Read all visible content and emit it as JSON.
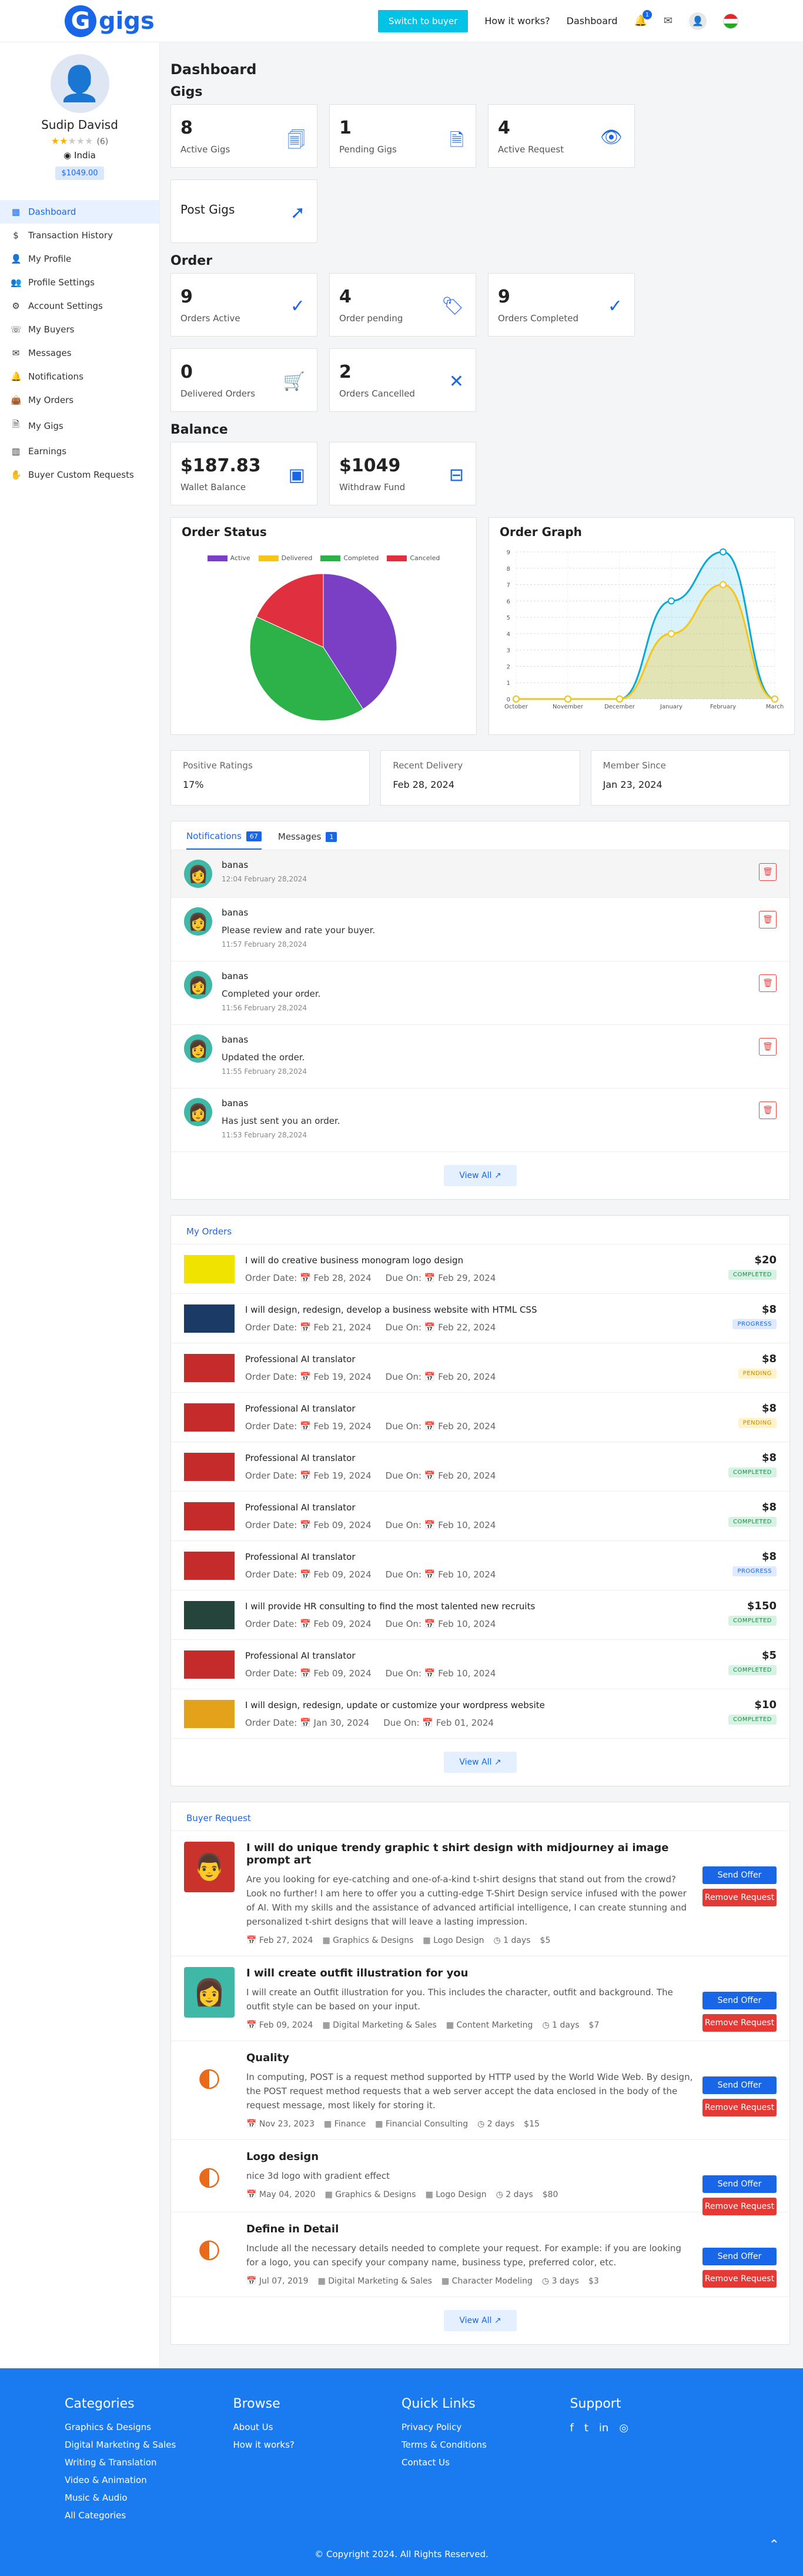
{
  "brand": {
    "logo_letter": "G",
    "logo_text": "gigs"
  },
  "topnav": {
    "switch_label": "Switch to buyer",
    "how": "How it works?",
    "dashboard": "Dashboard",
    "notif_count": "1"
  },
  "profile": {
    "name": "Sudip Davisd",
    "rating_count": "(6)",
    "country": "India",
    "wallet": "$1049.00",
    "rating": 2
  },
  "sidebar": [
    {
      "label": "Dashboard",
      "icon": "grid-icon"
    },
    {
      "label": "Transaction History",
      "icon": "dollar-icon"
    },
    {
      "label": "My Profile",
      "icon": "user-icon"
    },
    {
      "label": "Profile Settings",
      "icon": "users-icon"
    },
    {
      "label": "Account Settings",
      "icon": "gear-icon"
    },
    {
      "label": "My Buyers",
      "icon": "phone-icon"
    },
    {
      "label": "Messages",
      "icon": "mail-icon"
    },
    {
      "label": "Notifications",
      "icon": "bell-icon"
    },
    {
      "label": "My Orders",
      "icon": "bag-icon"
    },
    {
      "label": "My Gigs",
      "icon": "file-icon"
    },
    {
      "label": "Earnings",
      "icon": "chart-icon"
    },
    {
      "label": "Buyer Custom Requests",
      "icon": "hand-icon"
    }
  ],
  "dashboard": {
    "title": "Dashboard",
    "gigs_title": "Gigs",
    "order_title": "Order",
    "balance_title": "Balance"
  },
  "gigs": [
    {
      "num": "8",
      "label": "Active Gigs",
      "icon": "document-icon"
    },
    {
      "num": "1",
      "label": "Pending Gigs",
      "icon": "file-icon"
    },
    {
      "num": "4",
      "label": "Active Request",
      "icon": "eye-icon"
    },
    {
      "num": "",
      "label": "Post Gigs",
      "icon": "cursor-icon"
    }
  ],
  "order": [
    {
      "num": "9",
      "label": "Orders Active",
      "icon": "check-icon"
    },
    {
      "num": "4",
      "label": "Order pending",
      "icon": "tag-icon"
    },
    {
      "num": "9",
      "label": "Orders Completed",
      "icon": "check-icon"
    },
    {
      "num": "0",
      "label": "Delivered Orders",
      "icon": "cart-icon"
    },
    {
      "num": "2",
      "label": "Orders Cancelled",
      "icon": "close-icon"
    }
  ],
  "balance": [
    {
      "num": "$187.83",
      "label": "Wallet Balance",
      "icon": "wallet-icon"
    },
    {
      "num": "$1049",
      "label": "Withdraw Fund",
      "icon": "tray-icon"
    }
  ],
  "order_status": {
    "title": "Order Status",
    "colors": [
      "#7b3fc6",
      "#f5c518",
      "#2db24a",
      "#e0303f"
    ]
  },
  "order_graph": {
    "title": "Order Graph"
  },
  "chart_data": [
    {
      "type": "pie",
      "categories": [
        "Active",
        "Delivered",
        "Completed",
        "Canceled"
      ],
      "values": [
        9,
        0,
        9,
        4
      ],
      "title": "Order Status"
    },
    {
      "type": "area",
      "title": "Order Graph",
      "categories": [
        "October",
        "November",
        "December",
        "January",
        "February",
        "March"
      ],
      "series": [
        {
          "values": [
            0,
            0,
            0,
            6,
            9,
            0
          ],
          "color": "#0aa8d6"
        },
        {
          "values": [
            0,
            0,
            0,
            4,
            7,
            0
          ],
          "color": "#f5c518"
        }
      ],
      "ylim": [
        0,
        9
      ],
      "yticks": [
        0,
        1,
        2,
        3,
        4,
        5,
        6,
        7,
        8,
        9
      ],
      "grid": true
    }
  ],
  "stats": [
    {
      "title": "Positive Ratings",
      "value": "17%"
    },
    {
      "title": "Recent Delivery",
      "value": "Feb 28, 2024"
    },
    {
      "title": "Member Since",
      "value": "Jan 23, 2024"
    }
  ],
  "notifications": {
    "tab_notifications": "Notifications",
    "tab_notifications_count": "67",
    "tab_messages": "Messages",
    "tab_messages_count": "1",
    "view_all": "View All ↗",
    "items": [
      {
        "who": "banas",
        "msg": "",
        "time": "12:04 February 28,2024"
      },
      {
        "who": "banas",
        "msg": "Please review and rate your buyer.",
        "time": "11:57 February 28,2024"
      },
      {
        "who": "banas",
        "msg": "Completed your order.",
        "time": "11:56 February 28,2024"
      },
      {
        "who": "banas",
        "msg": "Updated the order.",
        "time": "11:55 February 28,2024"
      },
      {
        "who": "banas",
        "msg": "Has just sent you an order.",
        "time": "11:53 February 28,2024"
      }
    ]
  },
  "orders": {
    "title": "My Orders",
    "view_all": "View All ↗",
    "items": [
      {
        "title": "I will do creative business monogram logo design",
        "order": "Order Date: 📅 Feb 28, 2024",
        "due": "Due On: 📅 Feb 29, 2024",
        "price": "$20",
        "status": "COMPLETED",
        "cls": "s-completed",
        "thumb": "#f0e300"
      },
      {
        "title": "I will design, redesign, develop a business website with HTML CSS",
        "order": "Order Date: 📅 Feb 21, 2024",
        "due": "Due On: 📅 Feb 22, 2024",
        "price": "$8",
        "status": "PROGRESS",
        "cls": "s-progress",
        "thumb": "#1c3a66"
      },
      {
        "title": "Professional AI translator",
        "order": "Order Date: 📅 Feb 19, 2024",
        "due": "Due On: 📅 Feb 20, 2024",
        "price": "$8",
        "status": "PENDING",
        "cls": "s-pending",
        "thumb": "#c62b2b"
      },
      {
        "title": "Professional AI translator",
        "order": "Order Date: 📅 Feb 19, 2024",
        "due": "Due On: 📅 Feb 20, 2024",
        "price": "$8",
        "status": "PENDING",
        "cls": "s-pending",
        "thumb": "#c62b2b"
      },
      {
        "title": "Professional AI translator",
        "order": "Order Date: 📅 Feb 19, 2024",
        "due": "Due On: 📅 Feb 20, 2024",
        "price": "$8",
        "status": "COMPLETED",
        "cls": "s-completed",
        "thumb": "#c62b2b"
      },
      {
        "title": "Professional AI translator",
        "order": "Order Date: 📅 Feb 09, 2024",
        "due": "Due On: 📅 Feb 10, 2024",
        "price": "$8",
        "status": "COMPLETED",
        "cls": "s-completed",
        "thumb": "#c62b2b"
      },
      {
        "title": "Professional AI translator",
        "order": "Order Date: 📅 Feb 09, 2024",
        "due": "Due On: 📅 Feb 10, 2024",
        "price": "$8",
        "status": "PROGRESS",
        "cls": "s-progress",
        "thumb": "#c62b2b"
      },
      {
        "title": "I will provide HR consulting to find the most talented new recruits",
        "order": "Order Date: 📅 Feb 09, 2024",
        "due": "Due On: 📅 Feb 10, 2024",
        "price": "$150",
        "status": "COMPLETED",
        "cls": "s-completed",
        "thumb": "#24443c"
      },
      {
        "title": "Professional AI translator",
        "order": "Order Date: 📅 Feb 09, 2024",
        "due": "Due On: 📅 Feb 10, 2024",
        "price": "$5",
        "status": "COMPLETED",
        "cls": "s-completed",
        "thumb": "#c62b2b"
      },
      {
        "title": "I will design, redesign, update or customize your wordpress website",
        "order": "Order Date: 📅 Jan 30, 2024",
        "due": "Due On: 📅 Feb 01, 2024",
        "price": "$10",
        "status": "COMPLETED",
        "cls": "s-completed",
        "thumb": "#e3a21a"
      }
    ]
  },
  "requests": {
    "title": "Buyer Request",
    "send": "Send Offer",
    "remove": "Remove Request",
    "view_all": "View All ↗",
    "items": [
      {
        "title": "I will do unique trendy graphic t shirt design with midjourney ai image prompt art",
        "desc": "Are you looking for eye-catching and one-of-a-kind t-shirt designs that stand out from the crowd? Look no further! I am here to offer you a cutting-edge T-Shirt Design service infused with the power of AI. With my skills and the assistance of advanced artificial intelligence, I can create stunning and personalized t-shirt designs that will leave a lasting impression.",
        "date": "📅 Feb 27, 2024",
        "cat": "▦ Graphics & Designs",
        "sub": "▦ Logo Design",
        "days": "◷ 1 days",
        "price": "$5",
        "av": "#c9332c",
        "glyph": "👨"
      },
      {
        "title": "I will create outfit illustration for you",
        "desc": "I will create an Outfit illustration for you. This includes the character, outfit and background. The outfit style can be based on your input.",
        "date": "📅 Feb 09, 2024",
        "cat": "▦ Digital Marketing & Sales",
        "sub": "▦ Content Marketing",
        "days": "◷ 1 days",
        "price": "$7",
        "av": "#3fb8a7",
        "glyph": "👩"
      },
      {
        "title": "Quality",
        "desc": "In computing, POST is a request method supported by HTTP used by the World Wide Web. By design, the POST request method requests that a web server accept the data enclosed in the body of the request message, most likely for storing it.",
        "date": "📅 Nov 23, 2023",
        "cat": "▦ Finance",
        "sub": "▦ Financial Consulting",
        "days": "◷ 2 days",
        "price": "$15",
        "av": "#ffffff",
        "glyph": "◐"
      },
      {
        "title": "Logo design",
        "desc": "nice 3d logo with gradient effect",
        "date": "📅 May 04, 2020",
        "cat": "▦ Graphics & Designs",
        "sub": "▦ Logo Design",
        "days": "◷ 2 days",
        "price": "$80",
        "av": "#ffffff",
        "glyph": "◐"
      },
      {
        "title": "Define in Detail",
        "desc": "Include all the necessary details needed to complete your request. For example: if you are looking for a logo, you can specify your company name, business type, preferred color, etc.",
        "date": "📅 Jul 07, 2019",
        "cat": "▦ Digital Marketing & Sales",
        "sub": "▦ Character Modeling",
        "days": "◷ 3 days",
        "price": "$3",
        "av": "#ffffff",
        "glyph": "◐"
      }
    ]
  },
  "footer": {
    "categories_title": "Categories",
    "categories": [
      "Graphics & Designs",
      "Digital Marketing & Sales",
      "Writing & Translation",
      "Video & Animation",
      "Music & Audio",
      "All Categories"
    ],
    "browse_title": "Browse",
    "browse": [
      "About Us",
      "How it works?"
    ],
    "quick_title": "Quick Links",
    "quick": [
      "Privacy Policy",
      "Terms & Conditions",
      "Contact Us"
    ],
    "support_title": "Support",
    "social": [
      "f",
      "t",
      "in",
      "◎"
    ],
    "copyright": "© Copyright 2024. All Rights Reserved.",
    "totop": "⌃"
  }
}
